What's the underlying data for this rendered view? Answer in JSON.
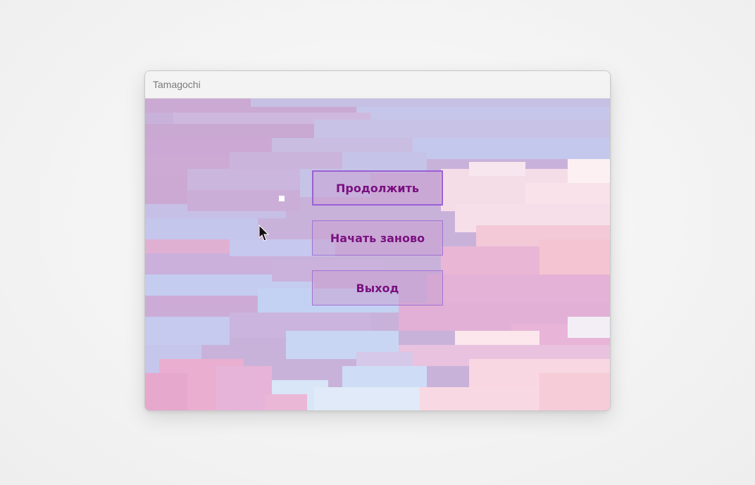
{
  "window": {
    "title": "Tamagochi"
  },
  "menu": {
    "continue_label": "Продолжить",
    "restart_label": "Начать заново",
    "exit_label": "Выход"
  },
  "colors": {
    "button_text": "#7a1080",
    "button_border": "#9a5fd6",
    "sky_lilac": "#c9acd4",
    "sky_blue": "#c4d2f2",
    "cloud_pink": "#f2c4d2"
  },
  "icons": {
    "pointer": "mouse-pointer-icon",
    "star": "star-pixel"
  }
}
